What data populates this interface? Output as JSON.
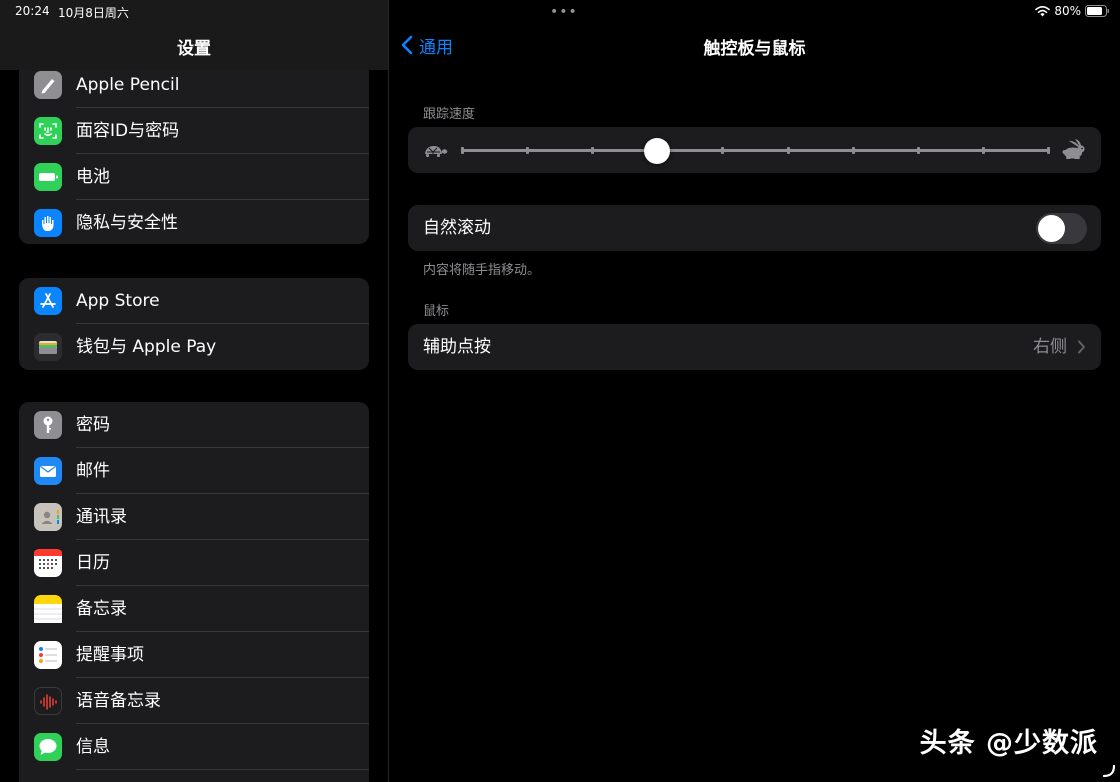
{
  "status_bar": {
    "time": "20:24",
    "date": "10月8日周六",
    "battery": "80%",
    "multitask": "•••"
  },
  "sidebar": {
    "title": "设置",
    "groups": [
      {
        "items": [
          {
            "label": "Apple Pencil",
            "icon": "pencil-icon",
            "color": "#8e8e93"
          },
          {
            "label": "面容ID与密码",
            "icon": "face-id-icon",
            "color": "#30d158"
          },
          {
            "label": "电池",
            "icon": "battery-icon",
            "color": "#30d158"
          },
          {
            "label": "隐私与安全性",
            "icon": "hand-icon",
            "color": "#0a84ff"
          }
        ]
      },
      {
        "items": [
          {
            "label": "App Store",
            "icon": "app-store-icon",
            "color": "#0a84ff"
          },
          {
            "label": "钱包与 Apple Pay",
            "icon": "wallet-icon",
            "color": "#2c2c2e"
          }
        ]
      },
      {
        "items": [
          {
            "label": "密码",
            "icon": "key-icon",
            "color": "#8e8e93"
          },
          {
            "label": "邮件",
            "icon": "mail-icon",
            "color": "#1e88f5"
          },
          {
            "label": "通讯录",
            "icon": "contacts-icon",
            "color": "#c7c2bb"
          },
          {
            "label": "日历",
            "icon": "calendar-icon",
            "color": "#ffffff"
          },
          {
            "label": "备忘录",
            "icon": "notes-icon",
            "color": "#ffd60a"
          },
          {
            "label": "提醒事项",
            "icon": "reminders-icon",
            "color": "#ffffff"
          },
          {
            "label": "语音备忘录",
            "icon": "voice-memos-icon",
            "color": "#1c1c1e"
          },
          {
            "label": "信息",
            "icon": "messages-icon",
            "color": "#30d158"
          }
        ]
      }
    ]
  },
  "detail": {
    "back_label": "通用",
    "title": "触控板与鼠标",
    "tracking": {
      "header": "跟踪速度",
      "ticks": 10,
      "value_index": 3,
      "value_fraction": 0.333
    },
    "natural_scroll": {
      "label": "自然滚动",
      "enabled": false,
      "footer": "内容将随手指移动。"
    },
    "mouse": {
      "header": "鼠标",
      "secondary_click_label": "辅助点按",
      "secondary_click_value": "右侧"
    }
  },
  "watermark": "头条 @少数派",
  "colors": {
    "accent": "#0a84ff",
    "cell_bg": "#1c1c1e",
    "secondary_text": "#8e8e93",
    "separator": "#38383a"
  }
}
